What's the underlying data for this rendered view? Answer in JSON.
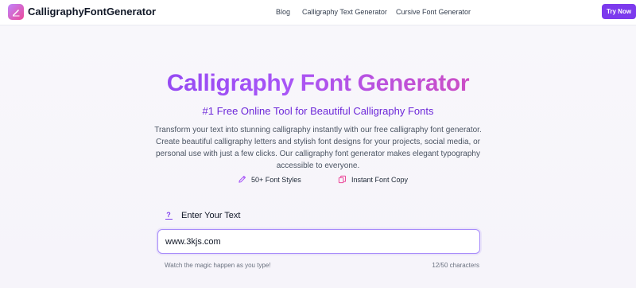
{
  "nav": {
    "brand": "CalligraphyFontGenerator",
    "links": [
      "Blog",
      "Calligraphy Text Generator",
      "Cursive Font Generator"
    ],
    "cta": "Try Now"
  },
  "hero": {
    "title": "Calligraphy Font Generator",
    "subtitle": "#1 Free Online Tool for Beautiful Calligraphy Fonts",
    "description": "Transform your text into stunning calligraphy instantly with our free calligraphy font generator. Create beautiful calligraphy letters and stylish font designs for your projects, social media, or personal use with just a few clicks. Our calligraphy font generator makes elegant typography accessible to everyone.",
    "features": [
      {
        "label": "50+ Font Styles",
        "icon": "pencil-icon"
      },
      {
        "label": "Instant Font Copy",
        "icon": "copy-icon"
      }
    ]
  },
  "input": {
    "label": "Enter Your Text",
    "icon": "question-icon",
    "value": "www.3kjs.com",
    "hint": "Watch the magic happen as you type!",
    "count": "12/50 characters"
  },
  "colors": {
    "accent": "#7c3aed",
    "gradient_start": "#7c3aed",
    "gradient_end": "#ec4899",
    "pink": "#ec4899"
  }
}
